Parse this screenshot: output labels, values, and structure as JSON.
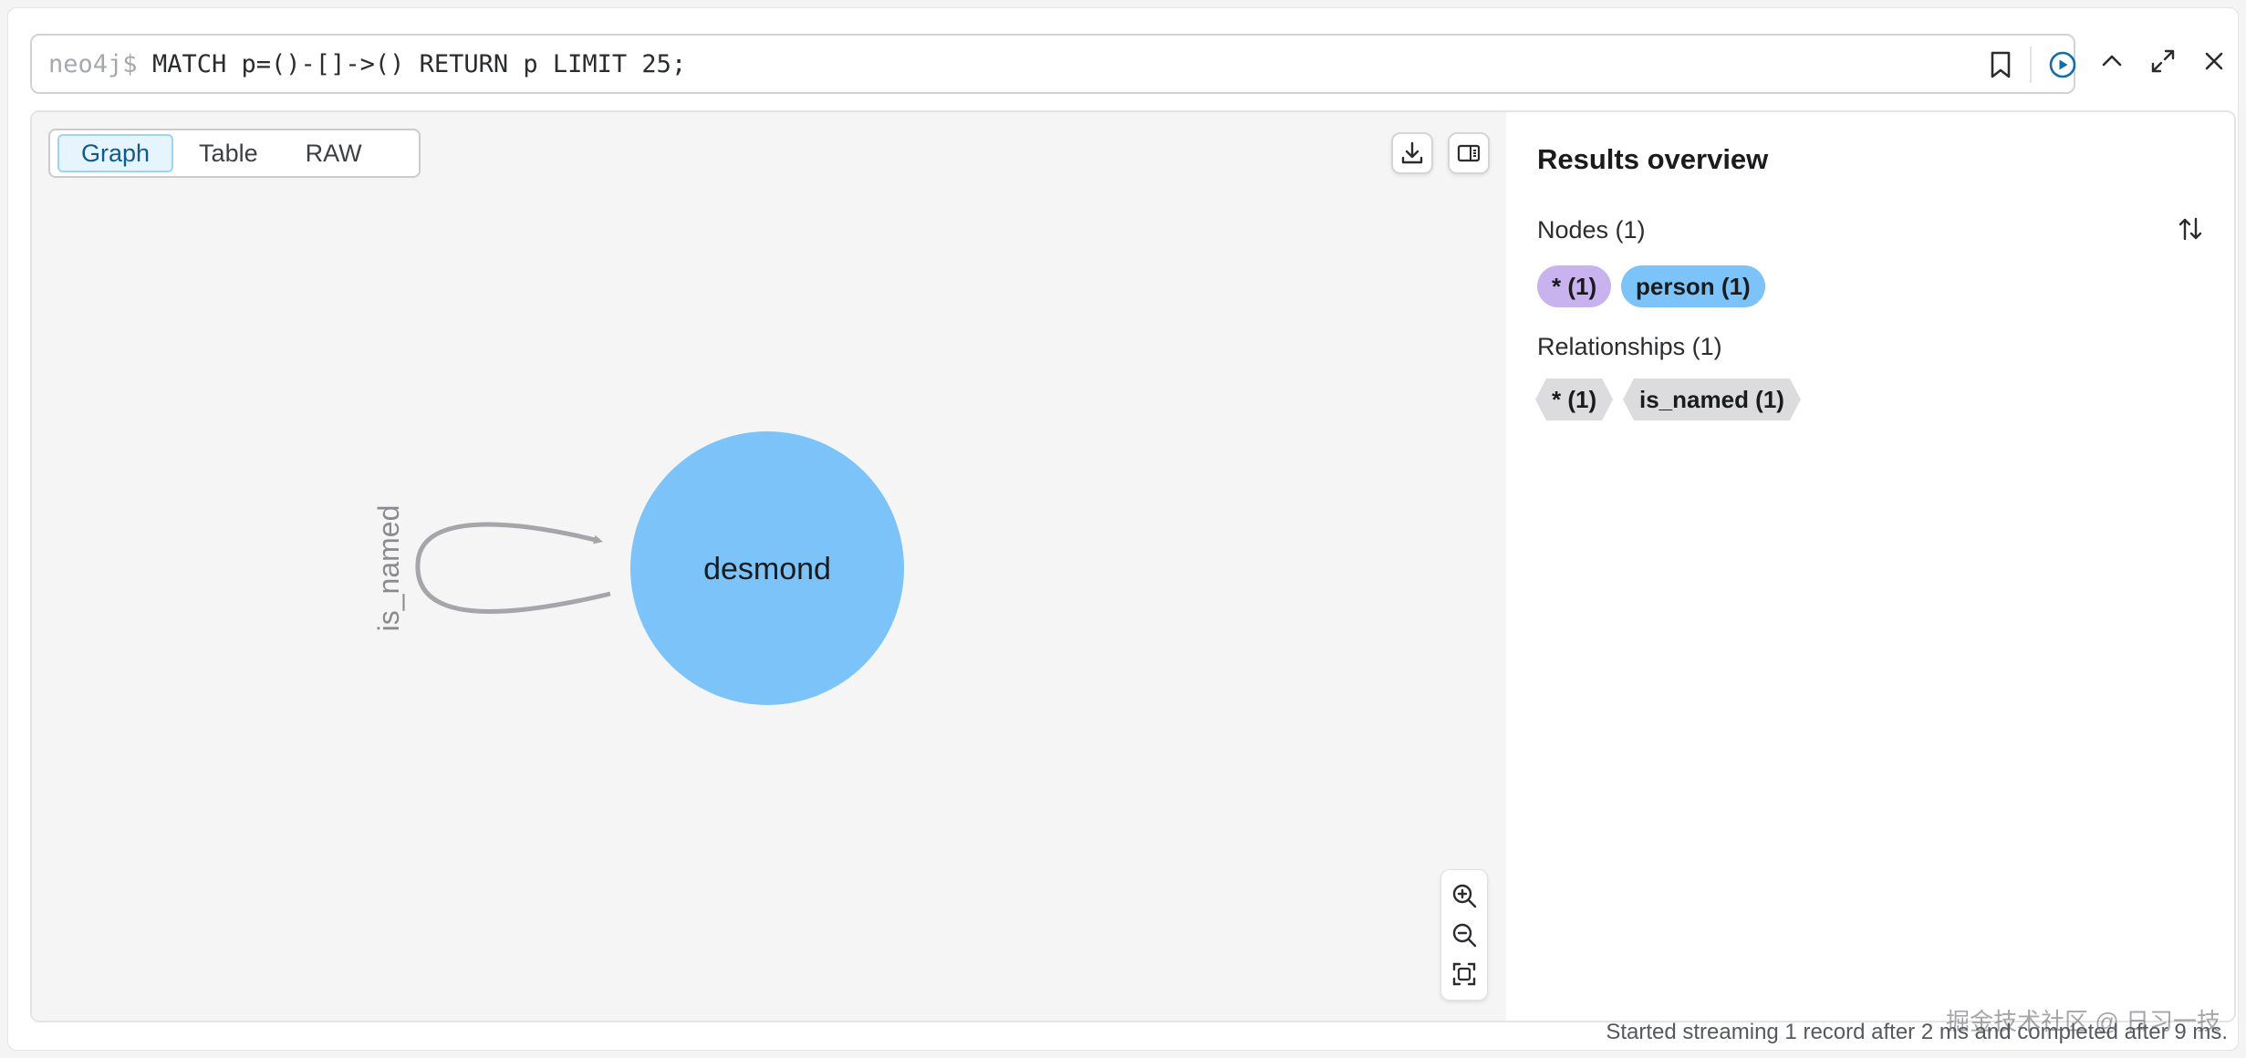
{
  "editor": {
    "prompt": "neo4j$",
    "query": "MATCH p=()-[]->() RETURN p LIMIT 25;"
  },
  "tabs": [
    {
      "label": "Graph",
      "active": true
    },
    {
      "label": "Table",
      "active": false
    },
    {
      "label": "RAW",
      "active": false
    }
  ],
  "graph": {
    "node": {
      "label": "desmond",
      "color": "#7cc3f9"
    },
    "relationship": {
      "label": "is_named",
      "color": "#a5a6aa"
    }
  },
  "overview": {
    "title": "Results overview",
    "nodes_label": "Nodes (1)",
    "node_pills": [
      {
        "label": "* (1)",
        "color": "#c9b3ee"
      },
      {
        "label": "person (1)",
        "color": "#7cc3f9"
      }
    ],
    "relationships_label": "Relationships (1)",
    "rel_tags": [
      {
        "label": "* (1)"
      },
      {
        "label": "is_named (1)"
      }
    ]
  },
  "status": "Started streaming 1 record after 2 ms and completed after 9 ms.",
  "watermark": "掘金技术社区 @ 日习一技",
  "icons": [
    "bookmark-icon",
    "play-circle-icon",
    "chevron-up-icon",
    "expand-icon",
    "close-icon",
    "download-icon",
    "panel-toggle-icon",
    "zoom-in-icon",
    "zoom-out-icon",
    "fit-to-screen-icon",
    "sort-icon"
  ]
}
